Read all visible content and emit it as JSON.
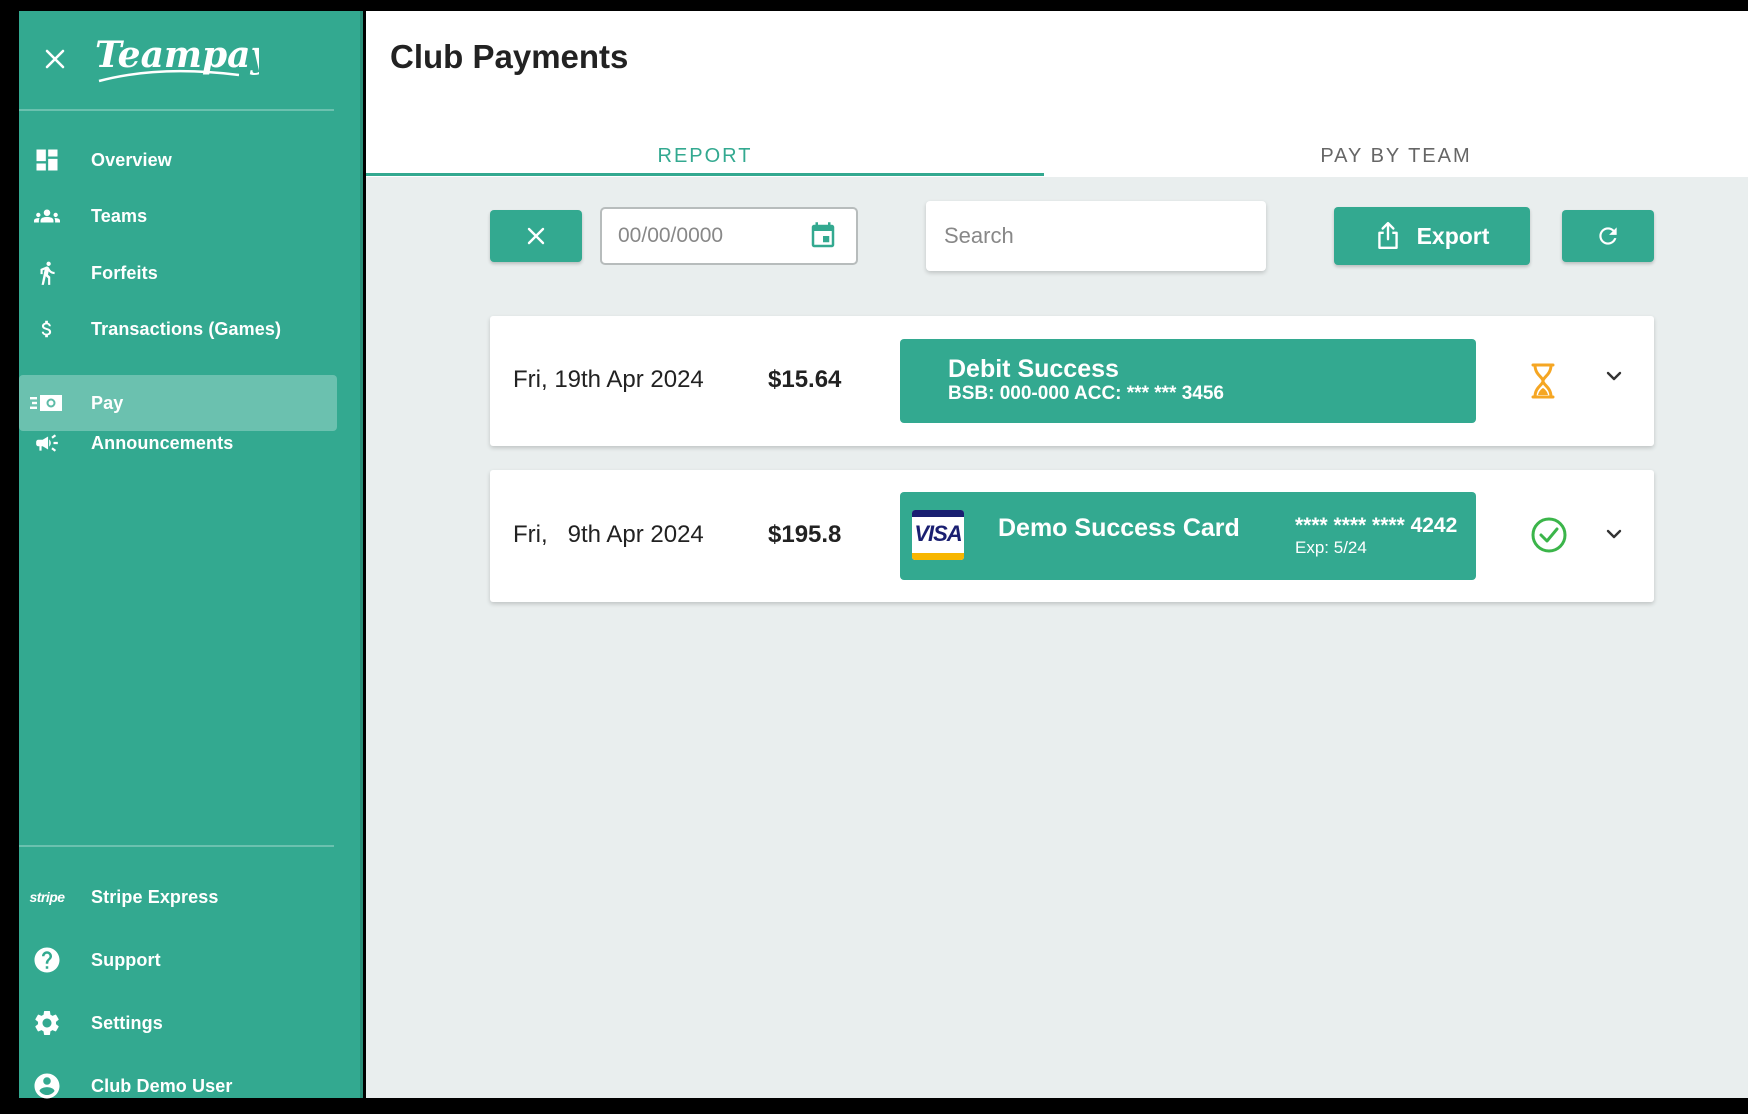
{
  "sidebar": {
    "logo_text": "Teampay",
    "nav_items": [
      {
        "label": "Overview",
        "icon": "dashboard-icon"
      },
      {
        "label": "Teams",
        "icon": "people-icon"
      },
      {
        "label": "Forfeits",
        "icon": "walking-person-icon"
      },
      {
        "label": "Transactions (Games)",
        "icon": "dollar-icon"
      },
      {
        "label": "Pay",
        "icon": "payments-icon",
        "active": true
      },
      {
        "label": "Announcements",
        "icon": "megaphone-icon"
      }
    ],
    "bottom_items": [
      {
        "label": "Stripe Express",
        "icon": "stripe-icon",
        "icon_text": "stripe"
      },
      {
        "label": "Support",
        "icon": "help-icon"
      },
      {
        "label": "Settings",
        "icon": "gear-icon"
      },
      {
        "label": "Club Demo User",
        "icon": "account-icon"
      }
    ]
  },
  "header": {
    "title": "Club Payments",
    "tabs": [
      {
        "label": "REPORT",
        "active": true
      },
      {
        "label": "PAY BY TEAM",
        "active": false
      }
    ]
  },
  "toolbar": {
    "date_placeholder": "00/00/0000",
    "search_placeholder": "Search",
    "export_label": "Export"
  },
  "payments": [
    {
      "date": "Fri, 19th Apr 2024",
      "amount": "$15.64",
      "method_type": "debit",
      "method_title": "Debit Success",
      "method_detail": "BSB: 000-000 ACC: *** *** 3456",
      "status": "pending",
      "status_icon": "hourglass-icon"
    },
    {
      "date": "Fri,   9th Apr 2024",
      "amount": "$195.8",
      "method_type": "card",
      "card_brand": "VISA",
      "method_title": "Demo Success Card",
      "card_number": "**** **** **** 4242",
      "card_exp": "Exp: 5/24",
      "status": "success",
      "status_icon": "check-circle-icon"
    }
  ],
  "colors": {
    "brand": "#33a990",
    "pending": "#f5a623",
    "success": "#3bb54a"
  }
}
